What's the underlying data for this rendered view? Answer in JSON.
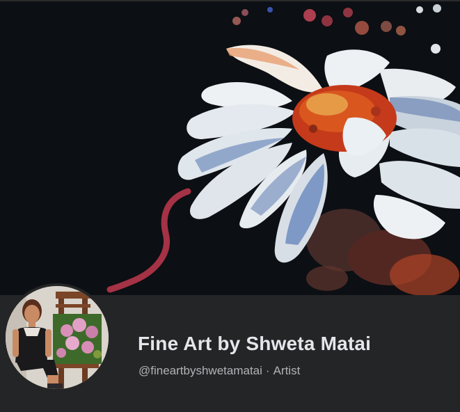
{
  "page": {
    "name": "Fine Art by Shweta Matai",
    "handle": "@fineartbyshwetamatai",
    "separator": "·",
    "category": "Artist"
  },
  "cover": {
    "description_icon": "flower-painting",
    "background_color": "#0c0f13"
  },
  "avatar": {
    "icon": "profile-photo"
  },
  "colors": {
    "background": "#242526",
    "title": "#e4e6eb",
    "meta": "#b0b3b8"
  }
}
